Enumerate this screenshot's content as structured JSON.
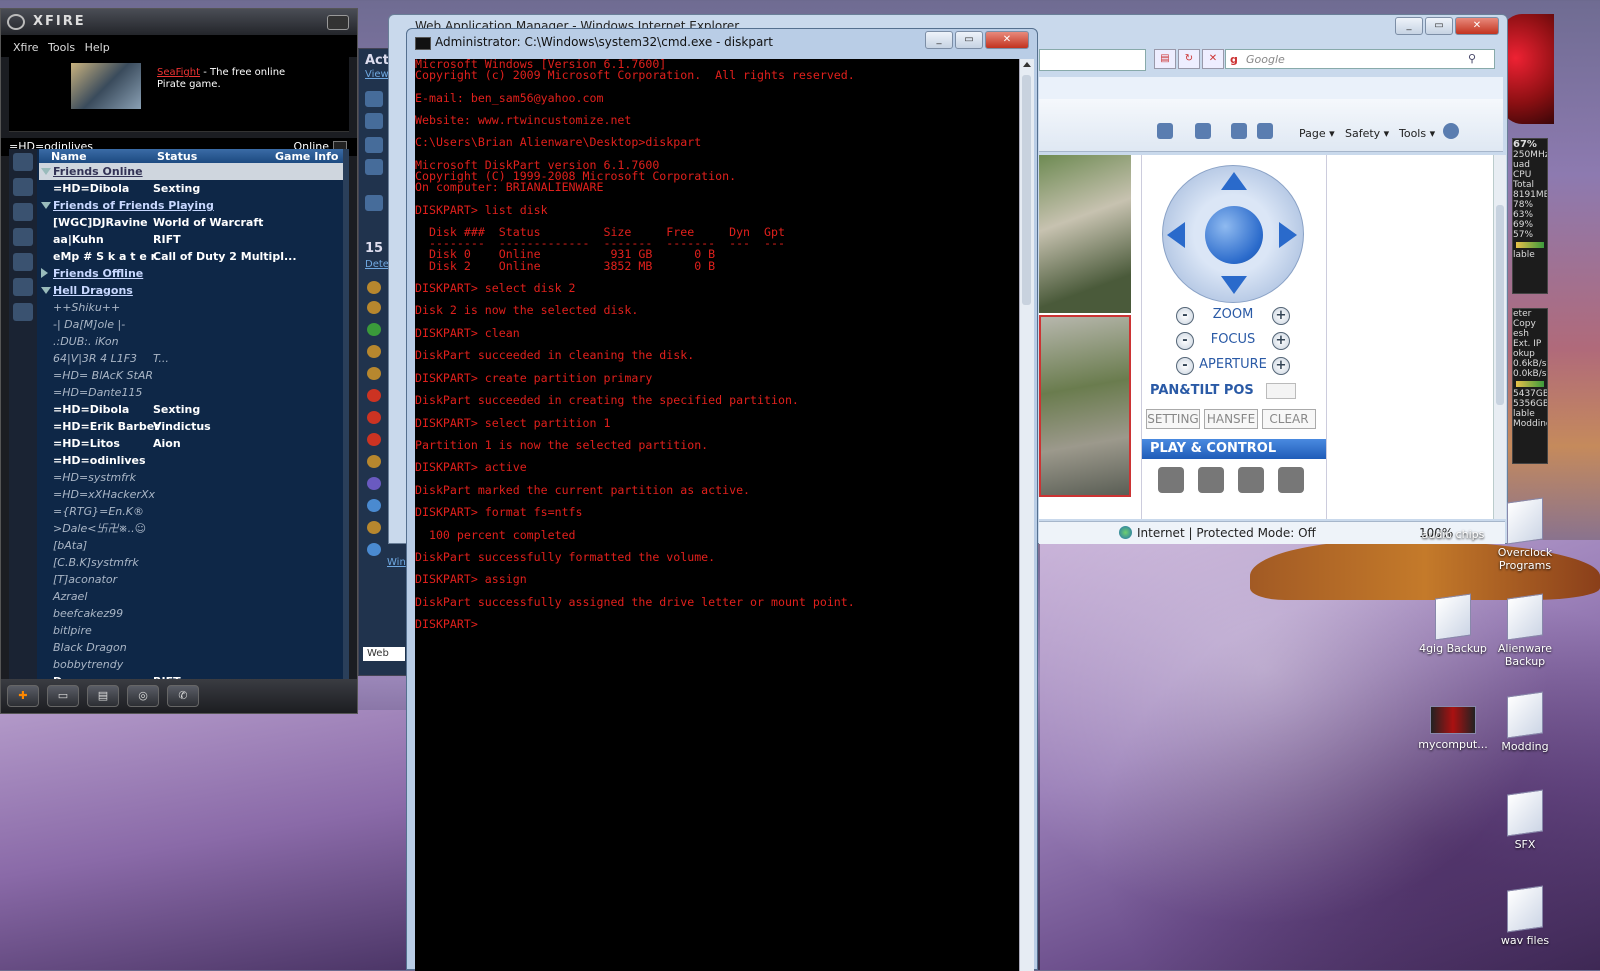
{
  "xfire": {
    "brand": "XFIRE",
    "menu": [
      "Xfire",
      "Tools",
      "Help"
    ],
    "ad": {
      "link": "SeaFight",
      "text": " - The free online Pirate game."
    },
    "user": "=HD=odinlives",
    "status": "Online",
    "columns": [
      "Name",
      "Status",
      "Game Info"
    ],
    "rows": [
      {
        "type": "grp",
        "name": "Friends Online",
        "sel": true
      },
      {
        "type": "b",
        "name": "=HD=Dibola",
        "status": "Sexting"
      },
      {
        "type": "grp",
        "name": "Friends of Friends Playing"
      },
      {
        "type": "b",
        "name": "[WGC]DJRavine",
        "status": "World of Warcraft"
      },
      {
        "type": "b",
        "name": "aa|Kuhn",
        "status": "RIFT"
      },
      {
        "type": "b",
        "name": "eMp # S k a t e r.",
        "status": "Call of Duty 2 Multipl..."
      },
      {
        "type": "grp",
        "name": "Friends Offline",
        "closed": true
      },
      {
        "type": "grp",
        "name": "Hell Dragons"
      },
      {
        "type": "i",
        "name": "++Shiku++"
      },
      {
        "type": "i",
        "name": "-| Da[M]ole |-"
      },
      {
        "type": "i",
        "name": ".:DUB:. iKon"
      },
      {
        "type": "i",
        "name": "64|V|3R 4 L1F3",
        "status": "T..."
      },
      {
        "type": "i",
        "name": "=HD= BlAcK StAR"
      },
      {
        "type": "i",
        "name": "=HD=Dante115"
      },
      {
        "type": "b",
        "name": "=HD=Dibola",
        "status": "Sexting"
      },
      {
        "type": "b",
        "name": "=HD=Erik Barber",
        "status": "Vindictus"
      },
      {
        "type": "b",
        "name": "=HD=Litos",
        "status": "Aion"
      },
      {
        "type": "b",
        "name": "=HD=odinlives"
      },
      {
        "type": "i",
        "name": "=HD=systmfrk"
      },
      {
        "type": "i",
        "name": "=HD=xXHackerXx"
      },
      {
        "type": "i",
        "name": "={RTG}=En.K®"
      },
      {
        "type": "i",
        "name": ">Dale<卐卍※..☺"
      },
      {
        "type": "i",
        "name": "[bAta]"
      },
      {
        "type": "i",
        "name": "[C.B.K]systmfrk"
      },
      {
        "type": "i",
        "name": "[T]aconator"
      },
      {
        "type": "i",
        "name": "Azrael"
      },
      {
        "type": "i",
        "name": "beefcakez99"
      },
      {
        "type": "i",
        "name": "bitlpire"
      },
      {
        "type": "i",
        "name": "Black Dragon"
      },
      {
        "type": "i",
        "name": "bobbytrendy"
      },
      {
        "type": "b",
        "name": "Draco",
        "status": "RIFT"
      }
    ]
  },
  "strip": {
    "act": "Acti",
    "view": "View",
    "count": "15 I",
    "det": "Dete",
    "win": "Win",
    "web": "Web"
  },
  "ie": {
    "title": "Web Application Manager - Windows Internet Explorer",
    "search_placeholder": "Google",
    "cmds": [
      "Page ▾",
      "Safety ▾",
      "Tools ▾"
    ],
    "ptz": {
      "zoom": "ZOOM",
      "focus": "FOCUS",
      "aperture": "APERTURE",
      "pantilt": "PAN&TILT POS",
      "buttons": [
        "SETTING",
        "HANSFE",
        "CLEAR"
      ],
      "play": "PLAY & CONTROL"
    },
    "status": "Internet | Protected Mode: Off",
    "zoom": "100%"
  },
  "cmd": {
    "title": "Administrator: C:\\Windows\\system32\\cmd.exe - diskpart",
    "text": "Microsoft Windows [Version 6.1.7600]\nCopyright (c) 2009 Microsoft Corporation.  All rights reserved.\n\nE-mail: ben_sam56@yahoo.com\n\nWebsite: www.rtwincustomize.net\n\nC:\\Users\\Brian Alienware\\Desktop>diskpart\n\nMicrosoft DiskPart version 6.1.7600\nCopyright (C) 1999-2008 Microsoft Corporation.\nOn computer: BRIANALIENWARE\n\nDISKPART> list disk\n\n  Disk ###  Status         Size     Free     Dyn  Gpt\n  --------  -------------  -------  -------  ---  ---\n  Disk 0    Online          931 GB      0 B\n  Disk 2    Online         3852 MB      0 B\n\nDISKPART> select disk 2\n\nDisk 2 is now the selected disk.\n\nDISKPART> clean\n\nDiskPart succeeded in cleaning the disk.\n\nDISKPART> create partition primary\n\nDiskPart succeeded in creating the specified partition.\n\nDISKPART> select partition 1\n\nPartition 1 is now the selected partition.\n\nDISKPART> active\n\nDiskPart marked the current partition as active.\n\nDISKPART> format fs=ntfs\n\n  100 percent completed\n\nDiskPart successfully formatted the volume.\n\nDISKPART> assign\n\nDiskPart successfully assigned the drive letter or mount point.\n\nDISKPART>"
  },
  "gadgets": {
    "cpu_pct": "67%",
    "cpu_mhz": "250MHz",
    "cpu_label": "uad CPU",
    "total": "Total",
    "mem": "8191MB",
    "bars": [
      "78%",
      "63%",
      "69%",
      "57%"
    ],
    "avail": "lable",
    "meter": "eter",
    "copy": "Copy",
    "ext": "esh Ext. IP",
    "rates": [
      "okup",
      "0.6kB/s",
      "0.0kB/s"
    ],
    "mem2": "5437GB",
    "mem3": "5356GB",
    "avail2": "lable",
    "modding": "Modding"
  },
  "desktop": [
    {
      "label": "audio chips"
    },
    {
      "label": "Overclock Programs"
    },
    {
      "label": "4gig Backup"
    },
    {
      "label": "Alienware Backup"
    },
    {
      "label": "mycomput..."
    },
    {
      "label": "Modding"
    },
    {
      "label": "SFX"
    },
    {
      "label": "wav files"
    }
  ],
  "colors": {
    "console_text": "#e0201c",
    "xfire_panel": "#0e2747",
    "ptz_blue": "#2a5aa6"
  }
}
